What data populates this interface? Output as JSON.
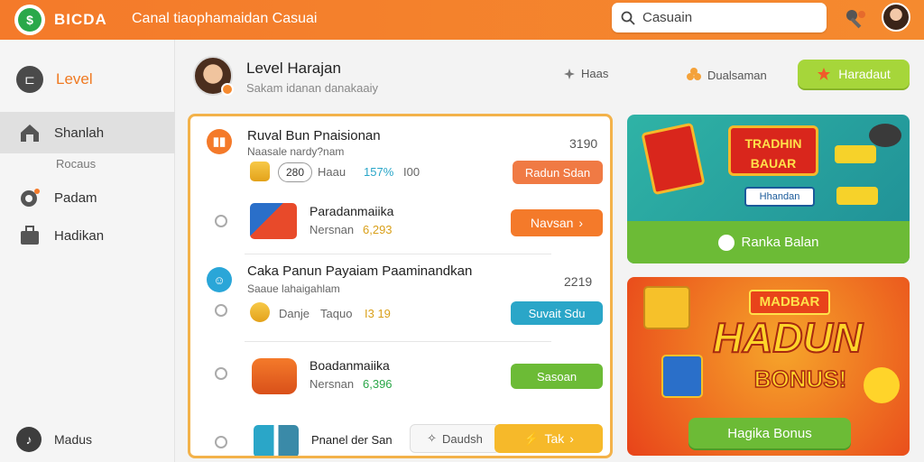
{
  "topbar": {
    "brand": "BICDA",
    "description": "Canal tiaophamaidan Casuai",
    "search_value": "Casuain"
  },
  "sidebar": {
    "level_label": "Level",
    "active_label": "Shanlah",
    "sub_label": "Rocaus",
    "item_padam": "Padam",
    "item_hadi": "Hadikan",
    "bottom_item": "Madus"
  },
  "profile": {
    "name": "Level Harajan",
    "subtitle": "Sakam idanan danakaaiy",
    "link1": "Haas",
    "link2": "Dualsaman",
    "claim_button": "Haradaut"
  },
  "tasks": [
    {
      "title": "Ruval Bun Pnaisionan",
      "subtitle": "Naasale nardy?nam",
      "number": "3190",
      "pill": "280",
      "meta": "Haau",
      "percent": "157%",
      "extra": "I00",
      "button": "Radun Sdan"
    },
    {
      "title": "Paradanmaiika",
      "subtitle": "Nersnan",
      "value": "6,293",
      "button": "Navsan"
    },
    {
      "title": "Caka Panun Payaiam Paaminandkan",
      "subtitle": "Saaue lahaigahlam",
      "number": "2219",
      "meta1": "Danje",
      "meta2": "Taquo",
      "value": "I3 19",
      "button": "Suvait Sdu"
    },
    {
      "title": "Boadanmaiika",
      "subtitle": "Nersnan",
      "value": "6,396",
      "button": "Sasoan"
    },
    {
      "title": "Pnanel der San",
      "sub_action": "Daudsh",
      "button": "Tak"
    }
  ],
  "cards": [
    {
      "banner": "TRADHIN BAUAR",
      "small1": "Hhandan",
      "button": "Ranka Balan"
    },
    {
      "banner_top": "MADBAR",
      "banner_main": "HADUN",
      "banner_sub": "BONUS!",
      "button": "Hagika Bonus"
    }
  ],
  "colors": {
    "accent": "#f47a2a",
    "green": "#7cc242",
    "yellow": "#f3b24a"
  }
}
